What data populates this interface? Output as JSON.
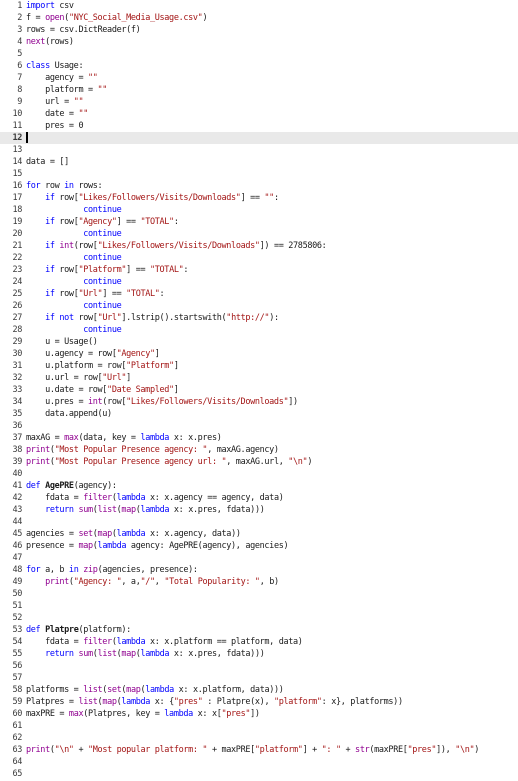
{
  "editor": {
    "lines": [
      {
        "n": "1",
        "code": "import csv"
      },
      {
        "n": "2",
        "code": "f = open(\"NYC_Social_Media_Usage.csv\")"
      },
      {
        "n": "3",
        "code": "rows = csv.DictReader(f)"
      },
      {
        "n": "4",
        "code": "next(rows)"
      },
      {
        "n": "5",
        "code": ""
      },
      {
        "n": "6",
        "code": "class Usage:"
      },
      {
        "n": "7",
        "code": "    agency = \"\""
      },
      {
        "n": "8",
        "code": "    platform = \"\""
      },
      {
        "n": "9",
        "code": "    url = \"\""
      },
      {
        "n": "10",
        "code": "    date = \"\""
      },
      {
        "n": "11",
        "code": "    pres = 0"
      },
      {
        "n": "12",
        "code": ""
      },
      {
        "n": "13",
        "code": ""
      },
      {
        "n": "14",
        "code": "data = []"
      },
      {
        "n": "15",
        "code": ""
      },
      {
        "n": "16",
        "code": "for row in rows:"
      },
      {
        "n": "17",
        "code": "    if row[\"Likes/Followers/Visits/Downloads\"] == \"\":"
      },
      {
        "n": "18",
        "code": "            continue"
      },
      {
        "n": "19",
        "code": "    if row[\"Agency\"] == \"TOTAL\":"
      },
      {
        "n": "20",
        "code": "            continue"
      },
      {
        "n": "21",
        "code": "    if int(row[\"Likes/Followers/Visits/Downloads\"]) == 2785806:"
      },
      {
        "n": "22",
        "code": "            continue"
      },
      {
        "n": "23",
        "code": "    if row[\"Platform\"] == \"TOTAL\":"
      },
      {
        "n": "24",
        "code": "            continue"
      },
      {
        "n": "25",
        "code": "    if row[\"Url\"] == \"TOTAL\":"
      },
      {
        "n": "26",
        "code": "            continue"
      },
      {
        "n": "27",
        "code": "    if not row[\"Url\"].lstrip().startswith(\"http://\"):"
      },
      {
        "n": "28",
        "code": "            continue"
      },
      {
        "n": "29",
        "code": "    u = Usage()"
      },
      {
        "n": "30",
        "code": "    u.agency = row[\"Agency\"]"
      },
      {
        "n": "31",
        "code": "    u.platform = row[\"Platform\"]"
      },
      {
        "n": "32",
        "code": "    u.url = row[\"Url\"]"
      },
      {
        "n": "33",
        "code": "    u.date = row[\"Date Sampled\"]"
      },
      {
        "n": "34",
        "code": "    u.pres = int(row[\"Likes/Followers/Visits/Downloads\"])"
      },
      {
        "n": "35",
        "code": "    data.append(u)"
      },
      {
        "n": "36",
        "code": ""
      },
      {
        "n": "37",
        "code": "maxAG = max(data, key = lambda x: x.pres)"
      },
      {
        "n": "38",
        "code": "print(\"Most Popular Presence agency: \", maxAG.agency)"
      },
      {
        "n": "39",
        "code": "print(\"Most Popular Presence agency url: \", maxAG.url, \"\\n\")"
      },
      {
        "n": "40",
        "code": ""
      },
      {
        "n": "41",
        "code": "def AgePRE(agency):"
      },
      {
        "n": "42",
        "code": "    fdata = filter(lambda x: x.agency == agency, data)"
      },
      {
        "n": "43",
        "code": "    return sum(list(map(lambda x: x.pres, fdata)))"
      },
      {
        "n": "44",
        "code": ""
      },
      {
        "n": "45",
        "code": "agencies = set(map(lambda x: x.agency, data))"
      },
      {
        "n": "46",
        "code": "presence = map(lambda agency: AgePRE(agency), agencies)"
      },
      {
        "n": "47",
        "code": ""
      },
      {
        "n": "48",
        "code": "for a, b in zip(agencies, presence):"
      },
      {
        "n": "49",
        "code": "    print(\"Agency: \", a,\"/\", \"Total Popularity: \", b)"
      },
      {
        "n": "50",
        "code": ""
      },
      {
        "n": "51",
        "code": ""
      },
      {
        "n": "52",
        "code": ""
      },
      {
        "n": "53",
        "code": "def Platpre(platform):"
      },
      {
        "n": "54",
        "code": "    fdata = filter(lambda x: x.platform == platform, data)"
      },
      {
        "n": "55",
        "code": "    return sum(list(map(lambda x: x.pres, fdata)))"
      },
      {
        "n": "56",
        "code": ""
      },
      {
        "n": "57",
        "code": ""
      },
      {
        "n": "58",
        "code": "platforms = list(set(map(lambda x: x.platform, data)))"
      },
      {
        "n": "59",
        "code": "Platpres = list(map(lambda x: {\"pres\" : Platpre(x), \"platform\": x}, platforms))"
      },
      {
        "n": "60",
        "code": "maxPRE = max(Platpres, key = lambda x: x[\"pres\"])"
      },
      {
        "n": "61",
        "code": ""
      },
      {
        "n": "62",
        "code": ""
      },
      {
        "n": "63",
        "code": "print(\"\\n\" + \"Most popular platform: \" + maxPRE[\"platform\"] + \": \" + str(maxPRE[\"pres\"]), \"\\n\")"
      },
      {
        "n": "64",
        "code": ""
      },
      {
        "n": "65",
        "code": ""
      }
    ],
    "current_line": "12",
    "colors": {
      "keyword": "#0000ff",
      "builtin": "#900090",
      "string": "#a31515",
      "text": "#1a1a1a",
      "current_line_bg": "#e9e9e9"
    }
  }
}
